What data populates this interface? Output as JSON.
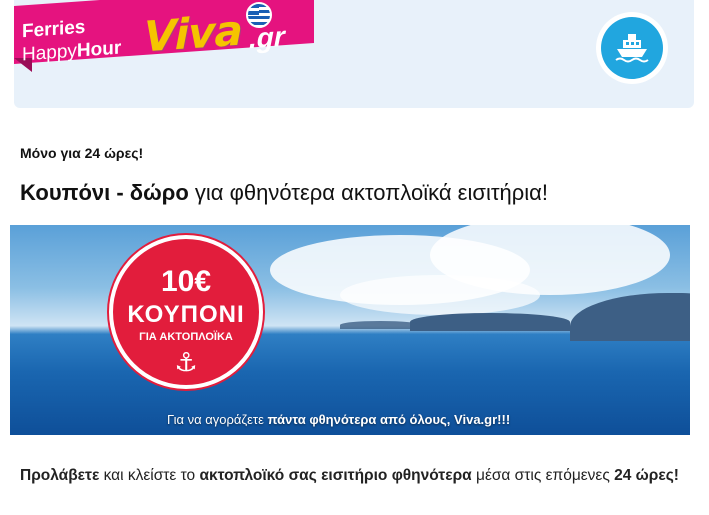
{
  "header": {
    "brand_line1": "Ferries",
    "brand_line2_a": "Happy",
    "brand_line2_b": "Hour",
    "logo_viva": "Viva",
    "logo_tld": ".gr",
    "ship_icon": "ship-icon",
    "colors": {
      "ribbon": "#e5137f",
      "badge": "#21a6df",
      "header_bg": "#e8f1fa"
    }
  },
  "kicker": "Μόνο για 24 ώρες!",
  "headline": {
    "bold": "Κουπόνι - δώρο",
    "rest": " για φθηνότερα ακτοπλοϊκά εισιτήρια!"
  },
  "banner": {
    "coupon_amount": "10€",
    "coupon_word": "ΚΟΥΠΟΝΙ",
    "coupon_sub": "ΓΙΑ ΑΚΤΟΠΛΟΪΚΑ",
    "coupon_icon": "anchor-icon",
    "caption_a": "Για να αγοράζετε ",
    "caption_b": "πάντα φθηνότερα από όλους, Viva.gr!!!"
  },
  "body": {
    "p1_b1": "Προλάβετε",
    "p1_t1": " και κλείστε το ",
    "p1_b2": "ακτοπλοϊκό σας εισιτήριο φθηνότερα",
    "p1_t2": " μέσα στις επόμενες ",
    "p1_b3": "24 ώρες!"
  }
}
